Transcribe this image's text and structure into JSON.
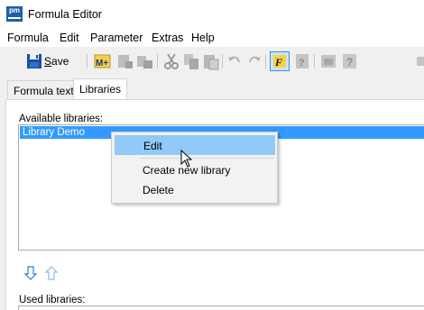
{
  "window": {
    "title": "Formula Editor",
    "app_icon_text": "pm"
  },
  "menubar": {
    "items": [
      "Formula",
      "Edit",
      "Parameter",
      "Extras",
      "Help"
    ]
  },
  "toolbar": {
    "save_label": "Save",
    "save_mnemonic": "S",
    "save_rest": "ave"
  },
  "tabs": [
    {
      "label": "Formula text",
      "active": false
    },
    {
      "label": "Libraries",
      "active": true
    }
  ],
  "libraries": {
    "available_label": "Available libraries:",
    "items": [
      "Library Demo"
    ],
    "selected": "Library Demo",
    "used_label": "Used libraries:"
  },
  "context_menu": {
    "items": [
      {
        "label": "Edit",
        "highlighted": true
      },
      {
        "label": "Create new library",
        "highlighted": false
      },
      {
        "label": "Delete",
        "highlighted": false
      }
    ]
  },
  "colors": {
    "selection": "#3399ff",
    "menu_highlight": "#91c9f7",
    "app_icon": "#1f5fa8"
  }
}
